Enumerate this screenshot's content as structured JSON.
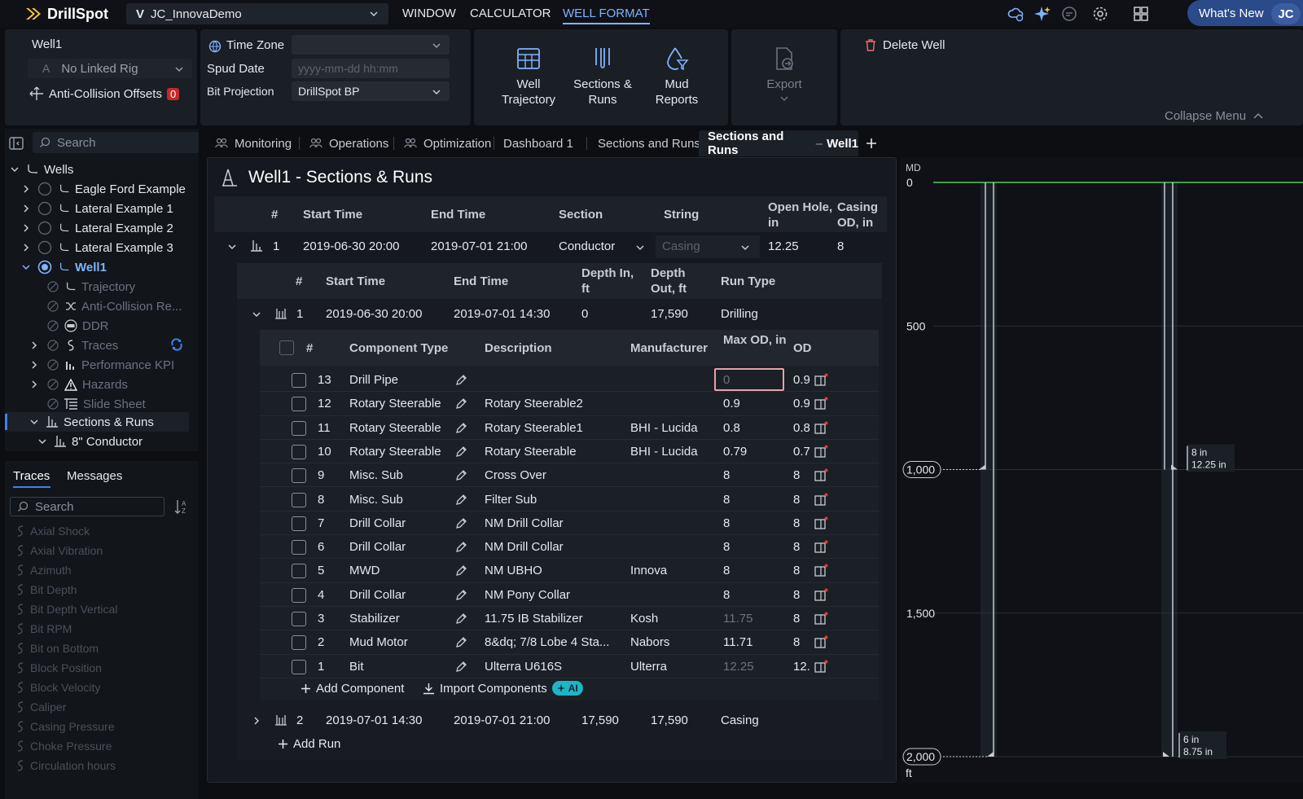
{
  "app": {
    "name": "DrillSpot",
    "project": "JC_InnovaDemo",
    "project_prefix": "V"
  },
  "topmenu": [
    "WINDOW",
    "CALCULATOR",
    "WELL FORMAT"
  ],
  "whats_new": "What's New",
  "user_initials": "JC",
  "ribbon": {
    "well_name": "Well1",
    "linked_rig": "No Linked Rig",
    "rig_prefix": "A",
    "anti_collision_label": "Anti-Collision Offsets",
    "anti_collision_count": "0",
    "time_zone_label": "Time Zone",
    "time_zone_value": "",
    "spud_date_label": "Spud Date",
    "spud_date_placeholder": "yyyy-mm-dd hh:mm",
    "bit_projection_label": "Bit Projection",
    "bit_projection_value": "DrillSpot BP",
    "btn_well_trajectory": [
      "Well",
      "Trajectory"
    ],
    "btn_sections_runs": [
      "Sections &",
      "Runs"
    ],
    "btn_mud_reports": [
      "Mud",
      "Reports"
    ],
    "btn_export": "Export",
    "delete_well": "Delete Well",
    "collapse_menu": "Collapse Menu"
  },
  "nav": {
    "search_placeholder": "Search",
    "root": "Wells",
    "wells": [
      "Eagle Ford Example",
      "Lateral Example 1",
      "Lateral Example 2",
      "Lateral Example 3"
    ],
    "active_well": "Well1",
    "children": [
      "Trajectory",
      "Anti-Collision Re...",
      "DDR",
      "Traces",
      "Performance KPI",
      "Hazards",
      "Slide Sheet"
    ],
    "sections_runs": "Sections & Runs",
    "conductor": "8\" Conductor"
  },
  "traces_panel": {
    "tab_traces": "Traces",
    "tab_messages": "Messages",
    "search_placeholder": "Search",
    "items": [
      "Axial Shock",
      "Axial Vibration",
      "Azimuth",
      "Bit Depth",
      "Bit Depth Vertical",
      "Bit RPM",
      "Bit on Bottom",
      "Block Position",
      "Block Velocity",
      "Caliper",
      "Casing Pressure",
      "Choke Pressure",
      "Circulation hours"
    ]
  },
  "tabs": [
    "Monitoring",
    "Operations",
    "Optimization",
    "Dashboard 1",
    "Sections and Runs"
  ],
  "active_tab": {
    "left": "Sections and Runs",
    "sep": "–",
    "right": "Well1"
  },
  "page_title": "Well1 - Sections & Runs",
  "sections_table": {
    "headers": [
      "#",
      "Start Time",
      "End Time",
      "Section",
      "String",
      "Open Hole, in",
      "Casing OD, in"
    ],
    "row": {
      "num": "1",
      "start": "2019-06-30 20:00",
      "end": "2019-07-01 21:00",
      "section": "Conductor",
      "string_placeholder": "Casing",
      "open_hole": "12.25",
      "casing_od": "8"
    }
  },
  "runs_table": {
    "headers": [
      "#",
      "Start Time",
      "End Time",
      "Depth In, ft",
      "Depth Out, ft",
      "Run Type"
    ],
    "run1": {
      "num": "1",
      "start": "2019-06-30 20:00",
      "end": "2019-07-01 14:30",
      "depth_in": "0",
      "depth_out": "17,590",
      "type": "Drilling"
    },
    "run2": {
      "num": "2",
      "start": "2019-07-01 14:30",
      "end": "2019-07-01 21:00",
      "depth_in": "17,590",
      "depth_out": "17,590",
      "type": "Casing"
    },
    "add_run": "Add Run"
  },
  "components_table": {
    "headers": [
      "#",
      "Component Type",
      "Description",
      "Manufacturer",
      "Max OD, in",
      "OD"
    ],
    "rows": [
      {
        "num": "13",
        "type": "Drill Pipe",
        "desc": "",
        "mfr": "",
        "maxod": "0",
        "od": "0.9",
        "maxod_style": "input"
      },
      {
        "num": "12",
        "type": "Rotary Steerable",
        "desc": "Rotary Steerable2",
        "mfr": "",
        "maxod": "0.9",
        "od": "0.9",
        "maxod_style": ""
      },
      {
        "num": "11",
        "type": "Rotary Steerable",
        "desc": "Rotary Steerable1",
        "mfr": "BHI - Lucida",
        "maxod": "0.8",
        "od": "0.8",
        "maxod_style": ""
      },
      {
        "num": "10",
        "type": "Rotary Steerable",
        "desc": "Rotary Steerable",
        "mfr": "BHI - Lucida",
        "maxod": "0.79",
        "od": "0.7",
        "maxod_style": ""
      },
      {
        "num": "9",
        "type": "Misc. Sub",
        "desc": "Cross Over",
        "mfr": "",
        "maxod": "8",
        "od": "8",
        "maxod_style": ""
      },
      {
        "num": "8",
        "type": "Misc. Sub",
        "desc": "Filter Sub",
        "mfr": "",
        "maxod": "8",
        "od": "8",
        "maxod_style": ""
      },
      {
        "num": "7",
        "type": "Drill Collar",
        "desc": "NM Drill Collar",
        "mfr": "",
        "maxod": "8",
        "od": "8",
        "maxod_style": ""
      },
      {
        "num": "6",
        "type": "Drill Collar",
        "desc": "NM Drill Collar",
        "mfr": "",
        "maxod": "8",
        "od": "8",
        "maxod_style": ""
      },
      {
        "num": "5",
        "type": "MWD",
        "desc": "NM UBHO",
        "mfr": "Innova",
        "maxod": "8",
        "od": "8",
        "maxod_style": ""
      },
      {
        "num": "4",
        "type": "Drill Collar",
        "desc": "NM Pony Collar",
        "mfr": "",
        "maxod": "8",
        "od": "8",
        "maxod_style": ""
      },
      {
        "num": "3",
        "type": "Stabilizer",
        "desc": "11.75 IB Stabilizer",
        "mfr": "Kosh",
        "maxod": "11.75",
        "od": "8",
        "maxod_style": "dim"
      },
      {
        "num": "2",
        "type": "Mud Motor",
        "desc": "8&dq; 7/8 Lobe 4 Sta...",
        "mfr": "Nabors",
        "maxod": "11.71",
        "od": "8",
        "maxod_style": ""
      },
      {
        "num": "1",
        "type": "Bit",
        "desc": "Ulterra U616S",
        "mfr": "Ulterra",
        "maxod": "12.25",
        "od": "12.",
        "maxod_style": "dim"
      }
    ],
    "add_component": "Add Component",
    "import_components": "Import Components",
    "ai_badge": "AI"
  },
  "depth_chart": {
    "axis_label": "MD",
    "unit": "ft",
    "ticks": [
      "0",
      "500",
      "1,000",
      "1,500",
      "2,000"
    ],
    "tick_values": [
      0,
      500,
      1000,
      1500,
      2000
    ],
    "ann1": [
      "8 in",
      "12.25 in"
    ],
    "ann2": [
      "6 in",
      "8.75 in"
    ],
    "casing_depth": 1000,
    "hole_depth": 2000
  }
}
